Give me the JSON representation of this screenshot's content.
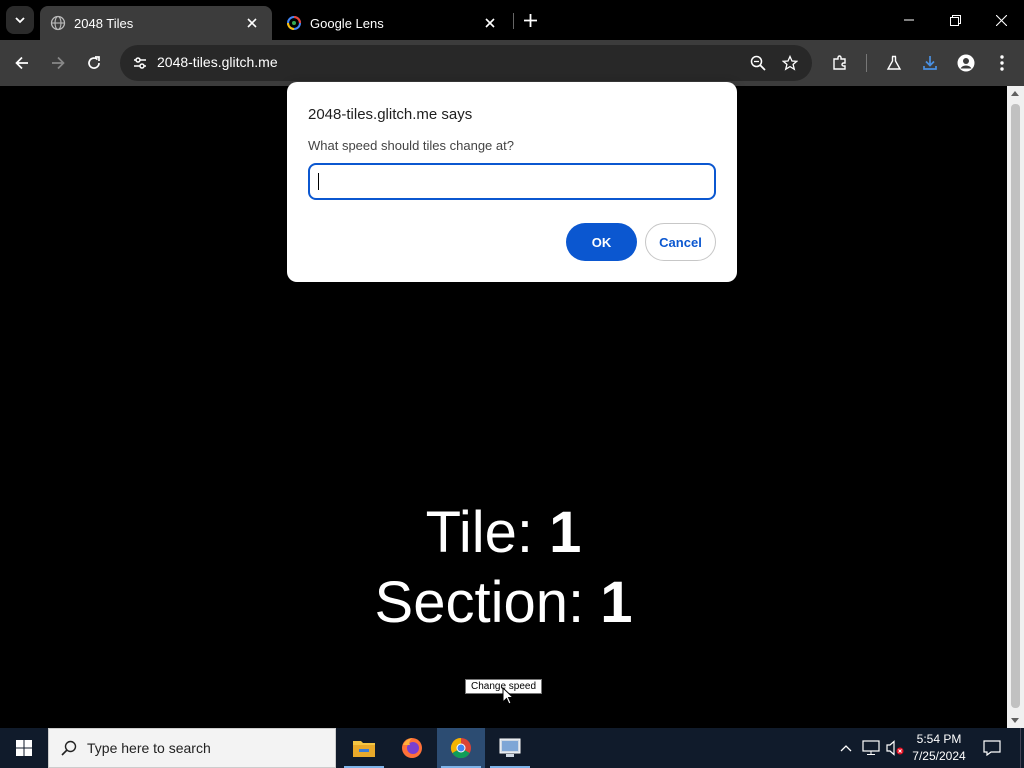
{
  "browser": {
    "tabs": [
      {
        "title": "2048 Tiles",
        "active": true,
        "icon": "globe-icon"
      },
      {
        "title": "Google Lens",
        "active": false,
        "icon": "google-lens-icon"
      }
    ],
    "url": "2048-tiles.glitch.me"
  },
  "page": {
    "tile_label": "Tile:",
    "tile_value": "1",
    "section_label": "Section:",
    "section_value": "1",
    "change_speed_label": "Change speed"
  },
  "dialog": {
    "title": "2048-tiles.glitch.me says",
    "message": "What speed should tiles change at?",
    "input_value": "",
    "ok_label": "OK",
    "cancel_label": "Cancel"
  },
  "taskbar": {
    "search_placeholder": "Type here to search",
    "apps": [
      "file-explorer-icon",
      "firefox-icon",
      "chrome-icon",
      "remote-desktop-icon"
    ],
    "time": "5:54 PM",
    "date": "7/25/2024"
  },
  "colors": {
    "accent": "#0b57d0",
    "chrome_dark": "#3c3c3c",
    "taskbar": "#101b2b"
  }
}
